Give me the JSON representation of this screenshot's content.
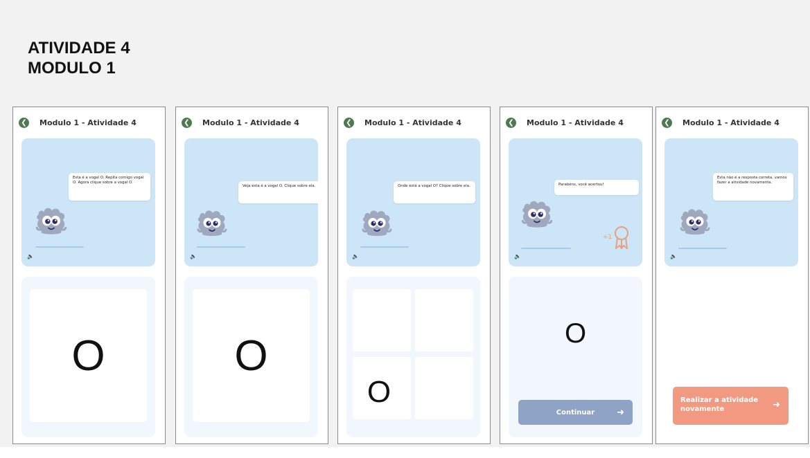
{
  "header": {
    "line1": "ATIVIDADE 4",
    "line2": "MODULO 1"
  },
  "screens": [
    {
      "title": "Modulo 1 - Atividade 4",
      "bubble": "Esta é a vogal O. Repita comigo vogal O. Agora clique sobre a vogal O.",
      "letter": "O"
    },
    {
      "title": "Modulo 1 - Atividade 4",
      "bubble": "Veja esta é a vogal O. Clique sobre ela.",
      "letter": "O"
    },
    {
      "title": "Modulo 1 - Atividade 4",
      "bubble": "Onde está a vogal O? Clique sobre ela.",
      "letter": "O"
    },
    {
      "title": "Modulo 1 - Atividade 4",
      "bubble": "Parabéns, você acertou!",
      "letter": "O",
      "reward": "+1",
      "button": "Continuar"
    },
    {
      "title": "Modulo 1 - Atividade 4",
      "bubble": "Esta não é a resposta correta, vamos fazer a atividade novamente.",
      "button": "Realizar a atividade novamente"
    }
  ],
  "icons": {
    "back": "arrow-left-circle",
    "speaker": "speaker",
    "arrow": "arrow-right",
    "reward": "ribbon-medal"
  },
  "colors": {
    "card_blue": "#cce5f7",
    "back_green": "#4f7a4f",
    "mascot": "#9fa8bd",
    "continue_button": "#8ea3c5",
    "retry_button": "#f19a81"
  }
}
